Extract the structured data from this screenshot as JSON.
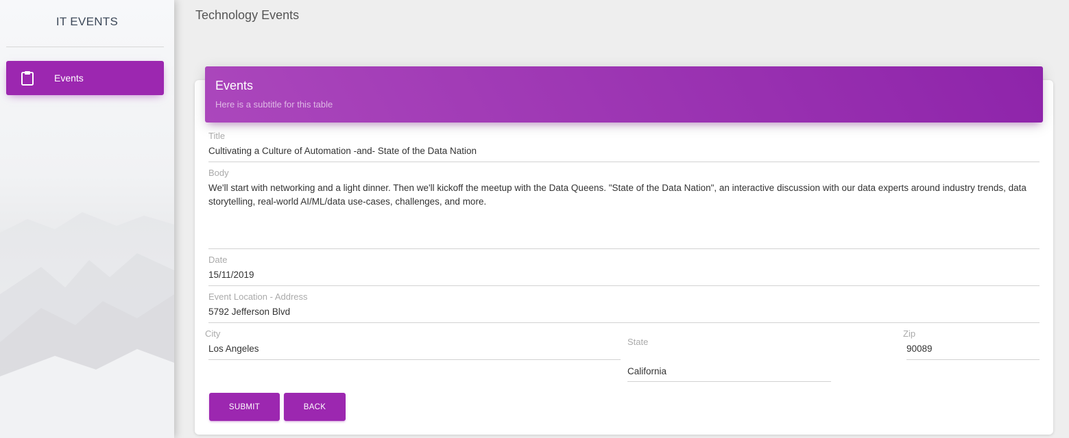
{
  "sidebar": {
    "brand": "IT EVENTS",
    "items": [
      {
        "label": "Events",
        "icon": "clipboard-icon",
        "active": true
      }
    ]
  },
  "header": {
    "title": "Technology Events"
  },
  "card": {
    "title": "Events",
    "subtitle": "Here is a subtitle for this table"
  },
  "form": {
    "title": {
      "label": "Title",
      "value": "Cultivating a Culture of Automation -and- State of the Data Nation"
    },
    "body": {
      "label": "Body",
      "value": "We'll start with networking and a light dinner. Then we'll kickoff the meetup with the Data Queens. \"State of the Data Nation\", an interactive discussion with our data experts around industry trends, data storytelling, real-world AI/ML/data use-cases, challenges, and more."
    },
    "date": {
      "label": "Date",
      "value": "15/11/2019"
    },
    "address": {
      "label": "Event Location - Address",
      "value": "5792 Jefferson Blvd"
    },
    "city": {
      "label": "City",
      "value": "Los Angeles"
    },
    "state": {
      "label": "State",
      "value": "California"
    },
    "zip": {
      "label": "Zip",
      "value": "90089"
    },
    "submit_label": "Submit",
    "back_label": "Back"
  },
  "colors": {
    "accent": "#9c27b0",
    "header_gradient_start": "#ab47bc",
    "header_gradient_end": "#8e24aa",
    "background": "#eeeeee"
  }
}
